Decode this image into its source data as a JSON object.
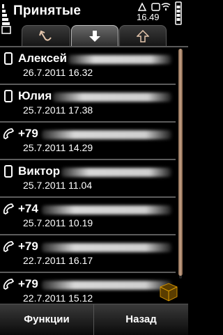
{
  "header": {
    "title": "Принятые",
    "time": "16.49"
  },
  "tabs": [
    {
      "icon": "missed-call-arrow-icon",
      "active": false
    },
    {
      "icon": "received-arrow-icon",
      "active": true
    },
    {
      "icon": "dialed-arrow-icon",
      "active": false
    }
  ],
  "calls": [
    {
      "type": "mobile-icon",
      "name": "Алексей",
      "date": "26.7.2011 16.32"
    },
    {
      "type": "mobile-icon",
      "name": "Юлия",
      "date": "25.7.2011 17.38"
    },
    {
      "type": "phone-handset-icon",
      "name": "+79",
      "date": "25.7.2011 14.29"
    },
    {
      "type": "mobile-icon",
      "name": "Виктор",
      "date": "25.7.2011 11.04"
    },
    {
      "type": "phone-handset-icon",
      "name": "+74",
      "date": "25.7.2011 10.19"
    },
    {
      "type": "phone-handset-icon",
      "name": "+79",
      "date": "22.7.2011 16.17"
    },
    {
      "type": "phone-handset-icon",
      "name": "+79",
      "date": "22.7.2011 15.12"
    }
  ],
  "softkeys": {
    "left": "Функции",
    "right": "Назад"
  },
  "colors": {
    "background": "#000000",
    "accent": "#c7a489",
    "divider": "#5c5c5c"
  }
}
